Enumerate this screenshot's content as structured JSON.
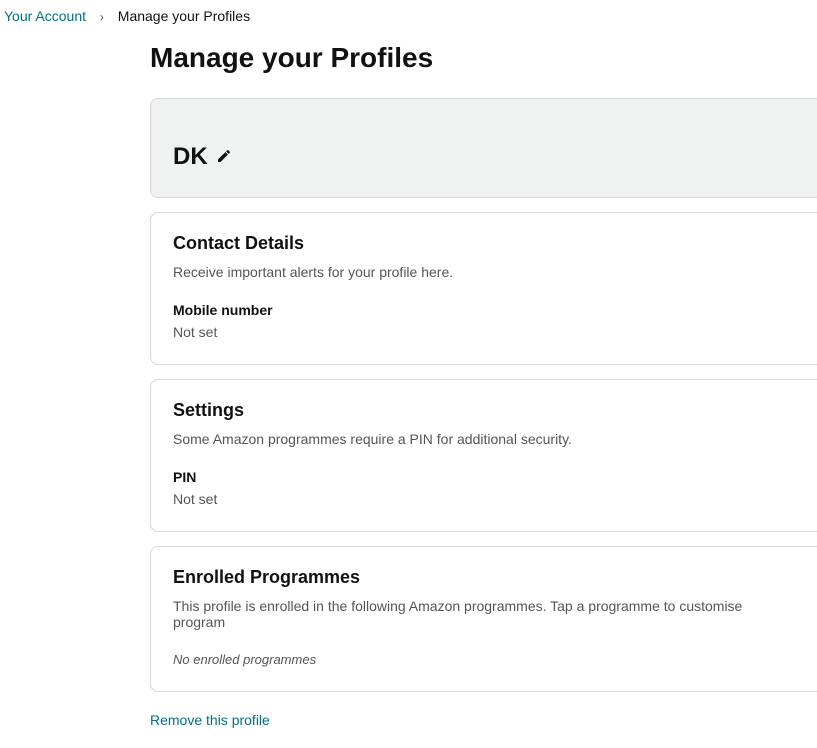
{
  "breadcrumb": {
    "root": "Your Account",
    "separator": "›",
    "current": "Manage your Profiles"
  },
  "page_title": "Manage your Profiles",
  "profile": {
    "name": "DK"
  },
  "contact": {
    "title": "Contact Details",
    "desc": "Receive important alerts for your profile here.",
    "mobile_label": "Mobile number",
    "mobile_value": "Not set"
  },
  "settings": {
    "title": "Settings",
    "desc": "Some Amazon programmes require a PIN for additional security.",
    "pin_label": "PIN",
    "pin_value": "Not set"
  },
  "enrolled": {
    "title": "Enrolled Programmes",
    "desc": "This profile is enrolled in the following Amazon programmes. Tap a programme to customise program",
    "empty": "No enrolled programmes"
  },
  "remove_label": "Remove this profile"
}
